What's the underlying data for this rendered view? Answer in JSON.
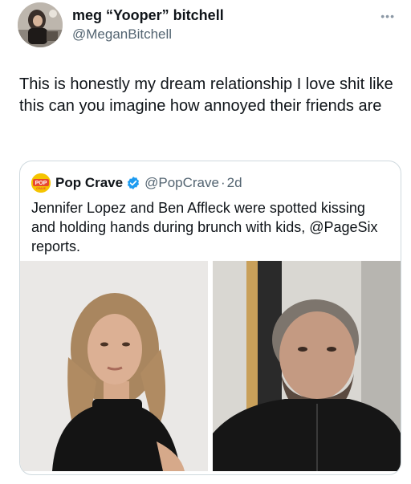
{
  "tweet": {
    "author": {
      "display_name": "meg “Yooper” bitchell",
      "handle": "@MeganBitchell",
      "avatar": "user-avatar-photo"
    },
    "more_icon": "more-dots-icon",
    "text": "This is honestly my dream relationship I love shit like this can you imagine how annoyed their friends are"
  },
  "quote": {
    "avatar_text": "POP",
    "avatar_subtext": "CRAVE",
    "display_name": "Pop Crave",
    "verified_icon": "verified-badge-icon",
    "handle": "@PopCrave",
    "separator": "·",
    "time": "2d",
    "text": "Jennifer Lopez and Ben Affleck were spotted kissing and holding hands during brunch with kids, @PageSix reports.",
    "images": [
      {
        "alt": "photo-woman-black-turtleneck"
      },
      {
        "alt": "photo-man-black-jacket"
      }
    ]
  },
  "colors": {
    "text": "#0f1419",
    "secondary": "#536471",
    "border": "#cfd9de",
    "verified": "#1d9bf0",
    "pop_crave_yellow": "#f5c400"
  }
}
